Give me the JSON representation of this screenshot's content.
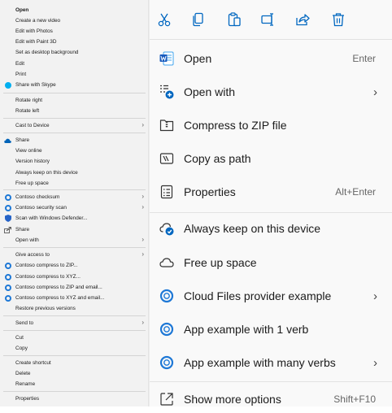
{
  "classic_menu": {
    "open": "Open",
    "create_video": "Create a new video",
    "edit_photos": "Edit with Photos",
    "edit_paint3d": "Edit with Paint 3D",
    "set_background": "Set as desktop background",
    "edit": "Edit",
    "print": "Print",
    "share_skype": "Share with Skype",
    "rotate_right": "Rotate right",
    "rotate_left": "Rotate left",
    "cast": "Cast to Device",
    "share": "Share",
    "view_online": "View online",
    "version_history": "Version history",
    "always_keep": "Always keep on this device",
    "free_up": "Free up space",
    "contoso_checksum": "Contoso checksum",
    "contoso_security": "Contoso security scan",
    "scan_defender": "Scan with Windows Defender...",
    "share2": "Share",
    "open_with": "Open with",
    "give_access": "Give access to",
    "compress_zip": "Contoso compress to ZIP...",
    "compress_xyz": "Contoso compress to XYZ...",
    "compress_zip_email": "Contoso compress to ZIP and email...",
    "compress_xyz_email": "Contoso compress to XYZ and email...",
    "restore": "Restore previous versions",
    "send_to": "Send to",
    "cut": "Cut",
    "copy": "Copy",
    "create_shortcut": "Create shortcut",
    "delete": "Delete",
    "rename": "Rename",
    "properties": "Properties"
  },
  "modern_menu": {
    "toolbar": [
      "cut-icon",
      "copy-icon",
      "paste-icon",
      "rename-icon",
      "share-icon",
      "delete-icon"
    ],
    "open": {
      "label": "Open",
      "shortcut": "Enter"
    },
    "open_with": {
      "label": "Open with"
    },
    "compress_zip": {
      "label": "Compress to ZIP file"
    },
    "copy_path": {
      "label": "Copy as path"
    },
    "properties": {
      "label": "Properties",
      "shortcut": "Alt+Enter"
    },
    "always_keep": {
      "label": "Always keep on this device"
    },
    "free_up": {
      "label": "Free up space"
    },
    "cloud_provider": {
      "label": "Cloud Files provider example"
    },
    "app_one_verb": {
      "label": "App example with 1 verb"
    },
    "app_many_verbs": {
      "label": "App example with many verbs"
    },
    "show_more": {
      "label": "Show more options",
      "shortcut": "Shift+F10"
    }
  },
  "colors": {
    "accent": "#0067c0",
    "word_blue": "#185abd",
    "skype": "#00aff0",
    "shield": "#2563c7"
  }
}
